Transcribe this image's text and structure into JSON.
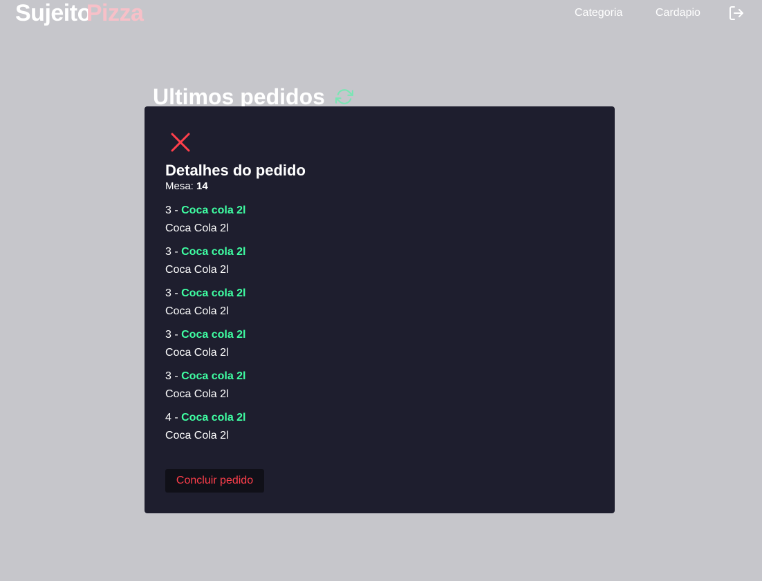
{
  "header": {
    "logo_part1": "Sujeito",
    "logo_part2": "Pizza",
    "nav": [
      {
        "label": "Categoria"
      },
      {
        "label": "Cardapio"
      }
    ],
    "logout_icon": "logout-icon"
  },
  "main": {
    "title": "Ultimos pedidos",
    "refresh_icon": "refresh-icon"
  },
  "modal": {
    "close_icon": "close-icon",
    "title": "Detalhes do pedido",
    "table_label": "Mesa:",
    "table_number": "14",
    "items": [
      {
        "amount": "3",
        "separator": " - ",
        "name": "Coca cola 2l",
        "description": "Coca Cola 2l"
      },
      {
        "amount": "3",
        "separator": " - ",
        "name": "Coca cola 2l",
        "description": "Coca Cola 2l"
      },
      {
        "amount": "3",
        "separator": " - ",
        "name": "Coca cola 2l",
        "description": "Coca Cola 2l"
      },
      {
        "amount": "3",
        "separator": " - ",
        "name": "Coca cola 2l",
        "description": "Coca Cola 2l"
      },
      {
        "amount": "3",
        "separator": " - ",
        "name": "Coca cola 2l",
        "description": "Coca Cola 2l"
      },
      {
        "amount": "4",
        "separator": " - ",
        "name": "Coca cola 2l",
        "description": "Coca Cola 2l"
      }
    ],
    "finish_label": "Concluir pedido"
  },
  "colors": {
    "background": "#c6c6cb",
    "modal_background": "#1e1e2e",
    "accent_green": "#3fffa3",
    "accent_red": "#ff3f4b",
    "logo_pink": "#f7c0c8"
  }
}
